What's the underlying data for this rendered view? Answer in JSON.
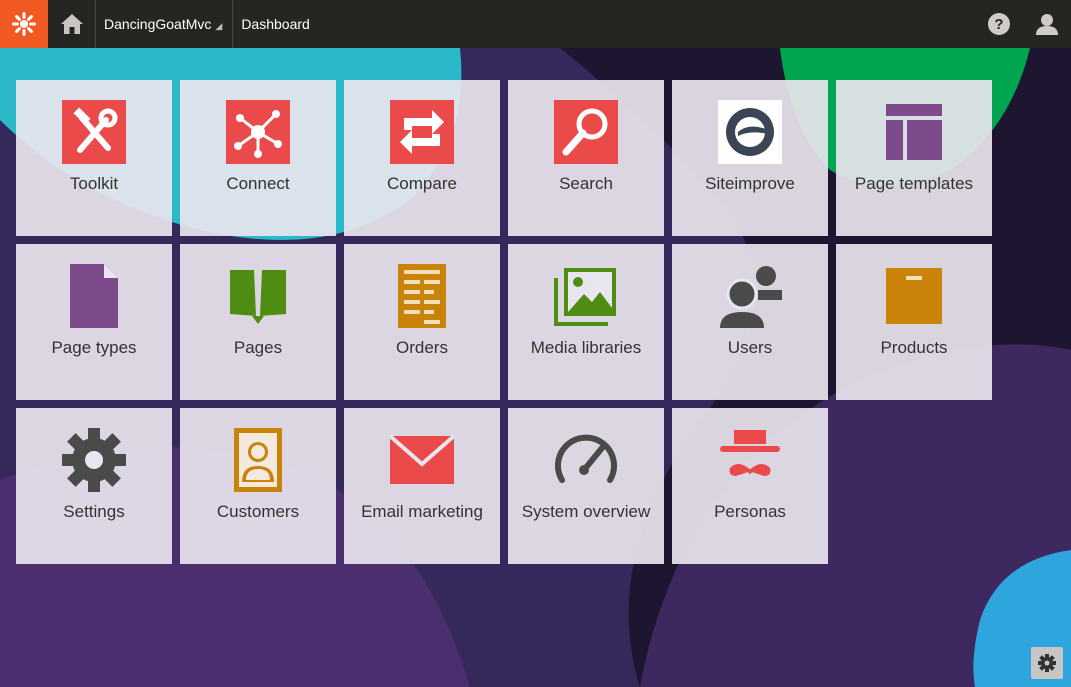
{
  "header": {
    "site_name": "DancingGoatMvc",
    "breadcrumb": "Dashboard",
    "logo_icon": "kentico-logo-icon",
    "home_icon": "home-icon",
    "help_icon": "help-icon",
    "user_icon": "user-icon"
  },
  "colors": {
    "header_bg": "#272522",
    "logo_bg": "#f05a22",
    "red": "#ea4a4a",
    "purple": "#7d4a8c",
    "green": "#4f8c12",
    "orange": "#c9820a",
    "dark": "#4a4a4a"
  },
  "tiles": [
    {
      "label": "Toolkit",
      "icon": "toolkit-icon"
    },
    {
      "label": "Connect",
      "icon": "connect-icon"
    },
    {
      "label": "Compare",
      "icon": "compare-icon"
    },
    {
      "label": "Search",
      "icon": "search-icon"
    },
    {
      "label": "Siteimprove",
      "icon": "siteimprove-icon"
    },
    {
      "label": "Page templates",
      "icon": "page-templates-icon"
    },
    {
      "label": "Page types",
      "icon": "page-types-icon"
    },
    {
      "label": "Pages",
      "icon": "pages-icon"
    },
    {
      "label": "Orders",
      "icon": "orders-icon"
    },
    {
      "label": "Media libraries",
      "icon": "media-libraries-icon"
    },
    {
      "label": "Users",
      "icon": "users-icon"
    },
    {
      "label": "Products",
      "icon": "products-icon"
    },
    {
      "label": "Settings",
      "icon": "settings-icon"
    },
    {
      "label": "Customers",
      "icon": "customers-icon"
    },
    {
      "label": "Email marketing",
      "icon": "email-marketing-icon"
    },
    {
      "label": "System overview",
      "icon": "system-overview-icon"
    },
    {
      "label": "Personas",
      "icon": "personas-icon"
    }
  ],
  "footer": {
    "settings_icon": "dashboard-settings-icon"
  }
}
